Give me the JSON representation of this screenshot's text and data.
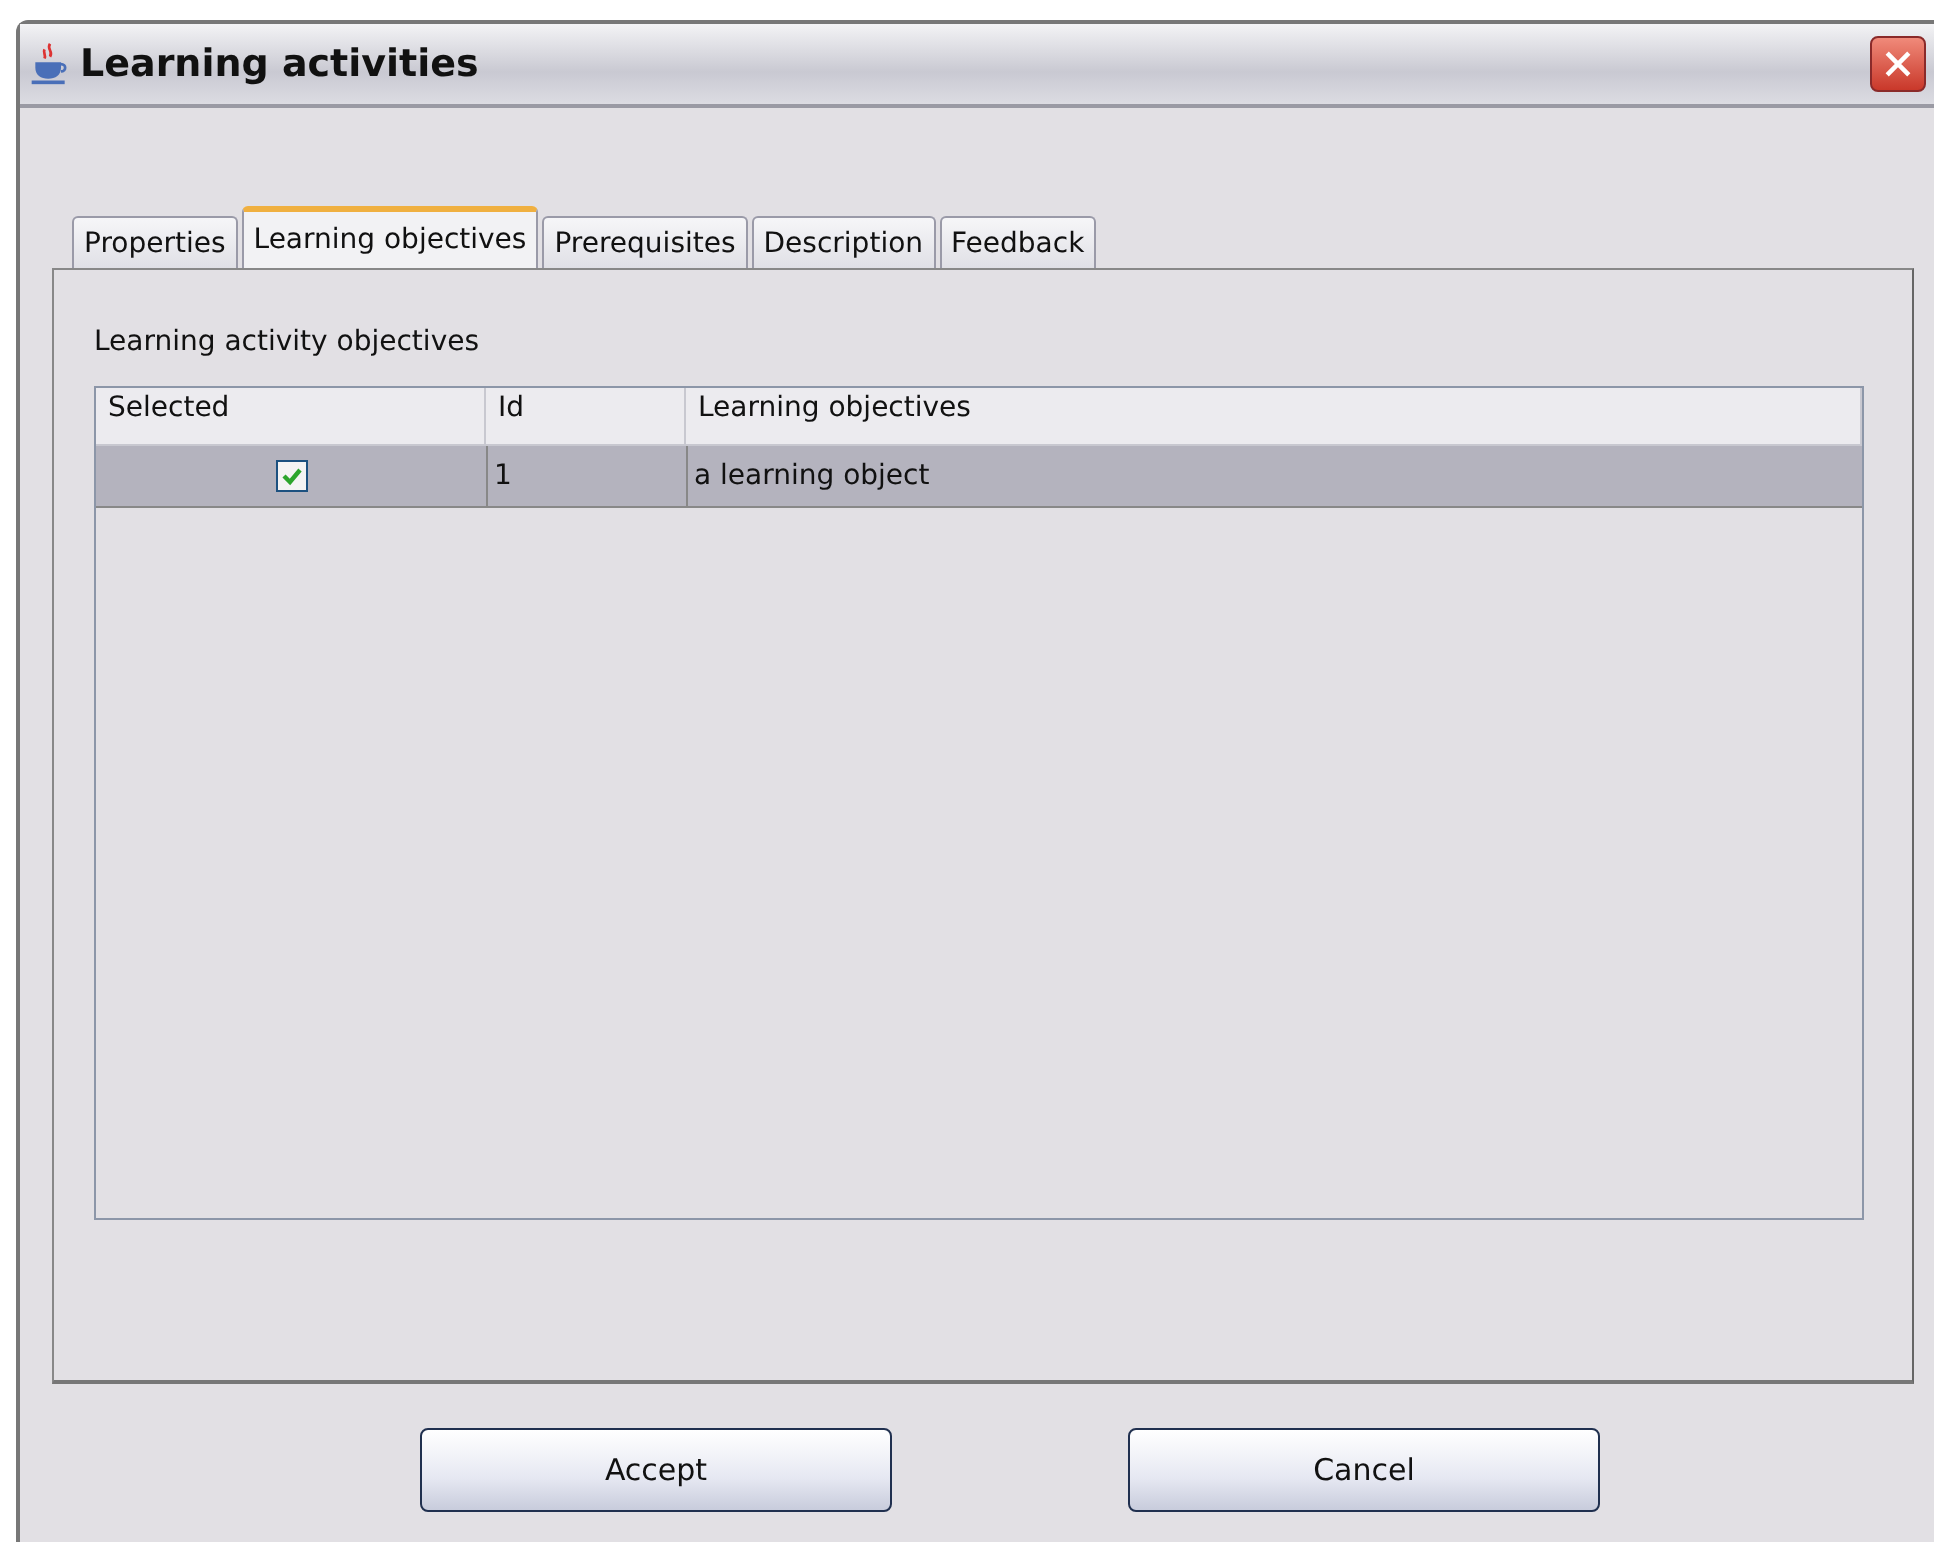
{
  "window": {
    "title": "Learning activities"
  },
  "tabs": [
    {
      "label": "Properties",
      "selected": false
    },
    {
      "label": "Learning objectives",
      "selected": true
    },
    {
      "label": "Prerequisites",
      "selected": false
    },
    {
      "label": "Description",
      "selected": false
    },
    {
      "label": "Feedback",
      "selected": false
    }
  ],
  "section_label": "Learning activity objectives",
  "table": {
    "columns": [
      "Selected",
      "Id",
      "Learning objectives"
    ],
    "rows": [
      {
        "checked": true,
        "id": "1",
        "objective": "a learning object",
        "selected": true
      }
    ]
  },
  "buttons": [
    "Accept",
    "Cancel"
  ]
}
